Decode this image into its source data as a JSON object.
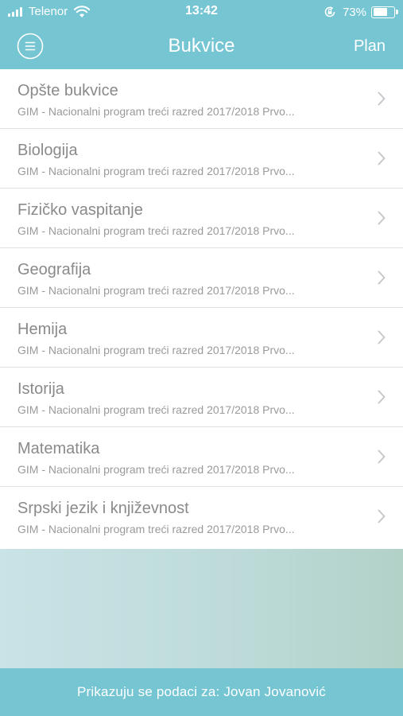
{
  "status_bar": {
    "carrier": "Telenor",
    "time": "13:42",
    "battery": "73%",
    "battery_level": 0.73,
    "signal_icon": "signal-bars-icon",
    "wifi_icon": "wifi-icon",
    "orientation_icon": "rotation-lock-icon",
    "battery_icon": "battery-icon"
  },
  "nav": {
    "title": "Bukvice",
    "right_button": "Plan",
    "menu_icon": "hamburger-menu-icon"
  },
  "list": {
    "chevron_icon": "chevron-right-icon",
    "items": [
      {
        "title": "Opšte bukvice",
        "subtitle": "GIM - Nacionalni program treći razred 2017/2018 Prvo..."
      },
      {
        "title": "Biologija",
        "subtitle": "GIM - Nacionalni program treći razred 2017/2018 Prvo..."
      },
      {
        "title": "Fizičko vaspitanje",
        "subtitle": "GIM - Nacionalni program treći razred 2017/2018 Prvo..."
      },
      {
        "title": "Geografija",
        "subtitle": "GIM - Nacionalni program treći razred 2017/2018 Prvo..."
      },
      {
        "title": "Hemija",
        "subtitle": "GIM - Nacionalni program treći razred 2017/2018 Prvo..."
      },
      {
        "title": "Istorija",
        "subtitle": "GIM - Nacionalni program treći razred 2017/2018 Prvo..."
      },
      {
        "title": "Matematika",
        "subtitle": "GIM - Nacionalni program treći razred 2017/2018 Prvo..."
      },
      {
        "title": "Srpski jezik i književnost",
        "subtitle": "GIM - Nacionalni program treći razred 2017/2018 Prvo..."
      }
    ]
  },
  "footer": {
    "text": "Prikazuju se podaci za: Jovan Jovanović"
  },
  "colors": {
    "accent": "#76c5d3",
    "text_primary": "#8a8a8a",
    "text_secondary": "#9a9a9a",
    "divider": "#e1e1e1",
    "background_gradient_start": "#c9e3e6",
    "background_gradient_end": "#b2d2c8"
  }
}
